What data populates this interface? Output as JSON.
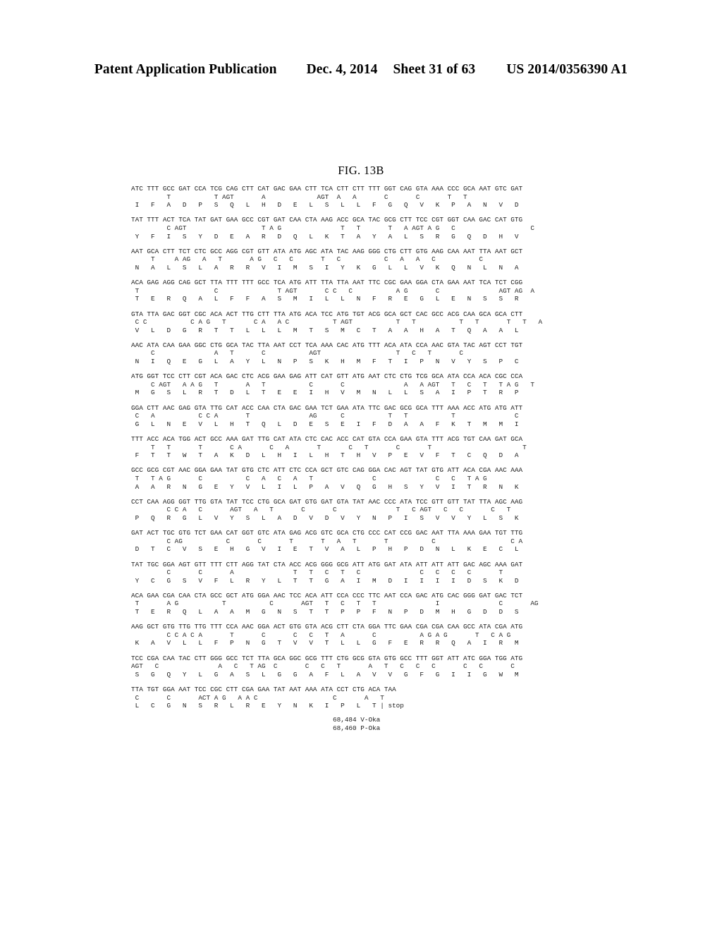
{
  "header": {
    "publication": "Patent Application Publication",
    "date": "Dec. 4, 2014",
    "sheet": "Sheet 31 of 63",
    "patent_number": "US 2014/0356390 A1"
  },
  "figure": {
    "title": "FIG. 13B"
  },
  "sequence": {
    "blocks": [
      {
        "codons": "ATC TTT GCC GAT CCA TCG CAG CTT CAT GAC GAA CTT TCA CTT CTT TTT GGT CAG GTA AAA CCC GCA AAT GTC GAT",
        "variants": "         T           T AGT       A             AGT  A   A       C       C       T   T",
        "protein": " I   F   A   D   P   S   Q   L   H   D   E   L   S   L   L   F   G   Q   V   K   P   A   N   V   D"
      },
      {
        "codons": "TAT TTT ACT TCA TAT GAT GAA GCC CGT GAT CAA CTA AAG ACC GCA TAC GCG CTT TCC CGT GGT CAA GAC CAT GTG",
        "variants": "         C AGT                   T A G               T   T       T   A AGT A G   C                   C",
        "protein": " Y   F   I   S   Y   D   E   A   R   D   Q   L   K   T   A   Y   A   L   S   R   G   Q   D   H   V"
      },
      {
        "codons": "AAT GCA CTT TCT CTC GCC AGG CGT GTT ATA ATG AGC ATA TAC AAG GGG CTG CTT GTG AAG CAA AAT TTA AAT GCT",
        "variants": "     T     A AG   A   T       A G   C   C       T   C           C   A   A   C           C",
        "protein": " N   A   L   S   L   A   R   R   V   I   M   S   I   Y   K   G   L   L   V   K   Q   N   L   N   A"
      },
      {
        "codons": "ACA GAG AGG CAG GCT TTA TTT TTT GCC TCA ATG ATT TTA TTA AAT TTC CGC GAA GGA CTA GAA AAT TCA TCT CGG",
        "variants": " T                   C               T AGT       C C   C           A G       C               AGT AG  A",
        "protein": " T   E   R   Q   A   L   F   F   A   S   M   I   L   L   N   F   R   E   G   L   E   N   S   S   R"
      },
      {
        "codons": "GTA TTA GAC GGT CGC ACA ACT TTG CTT TTA ATG ACA TCC ATG TGT ACG GCA GCT CAC GCC ACG CAA GCA GCA CTT",
        "variants": " C C           C A G   T       C A   A C           T AGT           T   T           T   T       T   T   A",
        "protein": " V   L   D   G   R   T   T   L   L   L   M   T   S   M   C   T   A   A   H   A   T   Q   A   A   L"
      },
      {
        "codons": "AAC ATA CAA GAA GGC CTG GCA TAC TTA AAT CCT TCA AAA CAC ATG TTT ACA ATA CCA AAC GTA TAC AGT CCT TGT",
        "variants": "     C               A   T       C           AGT                   T   C   T       C",
        "protein": " N   I   Q   E   G   L   A   Y   L   N   P   S   K   H   M   F   T   I   P   N   V   Y   S   P   C"
      },
      {
        "codons": "ATG GGT TCC CTT CGT ACA GAC CTC ACG GAA GAG ATT CAT GTT ATG AAT CTC CTG TCG GCA ATA CCA ACA CGC CCA",
        "variants": "     C AGT   A A G   T       A   T           C       C               A   A AGT   T   C   T   T A G   T",
        "protein": " M   G   S   L   R   T   D   L   T   E   E   I   H   V   M   N   L   L   S   A   I   P   T   R   P"
      },
      {
        "codons": "GGA CTT AAC GAG GTA TTG CAT ACC CAA CTA GAC GAA TCT GAA ATA TTC GAC GCG GCA TTT AAA ACC ATG ATG ATT",
        "variants": " C   A           C C A       T               AG      C           T   T           T               C",
        "protein": " G   L   N   E   V   L   H   T   Q   L   D   E   S   E   I   F   D   A   A   F   K   T   M   M   I"
      },
      {
        "codons": "TTT ACC ACA TGG ACT GCC AAA GAT TTG CAT ATA CTC CAC ACC CAT GTA CCA GAA GTA TTT ACG TGT CAA GAT GCA",
        "variants": "     T   T       T       C A       C   A       T       C   T       C       T                       T",
        "protein": " F   T   T   W   T   A   K   D   L   H   I   L   H   T   H   V   P   E   V   F   T   C   Q   D   A"
      },
      {
        "codons": "GCC GCG CGT AAC GGA GAA TAT GTG CTC ATT CTC CCA GCT GTC CAG GGA CAC AGT TAT GTG ATT ACA CGA AAC AAA",
        "variants": " T   T A G       C           C   A   C   A   T               C               C   C   T A G",
        "protein": " A   A   R   N   G   E   Y   V   L   I   L   P   A   V   Q   G   H   S   Y   V   I   T   R   N   K"
      },
      {
        "codons": "CCT CAA AGG GGT TTG GTA TAT TCC CTG GCA GAT GTG GAT GTA TAT AAC CCC ATA TCC GTT GTT TAT TTA AGC AAG",
        "variants": "         C C A   C       AGT   A   T       C       C               T   C AGT   C   C       C   T",
        "protein": " P   Q   R   G   L   V   Y   S   L   A   D   V   D   V   Y   N   P   I   S   V   V   Y   L   S   K"
      },
      {
        "codons": "GAT ACT TGC GTG TCT GAA CAT GGT GTC ATA GAG ACG GTC GCA CTG CCC CAT CCG GAC AAT TTA AAA GAA TGT TTG",
        "variants": "         C AG           C       C       T       T   A   T       T           C                   C A",
        "protein": " D   T   C   V   S   E   H   G   V   I   E   T   V   A   L   P   H   P   D   N   L   K   E   C   L"
      },
      {
        "codons": "TAT TGC GGA AGT GTT TTT CTT AGG TAT CTA ACC ACG GGG GCG ATT ATG GAT ATA ATT ATT ATT GAC AGC AAA GAT",
        "variants": "         C       C       A               T   T   C   T   C               C   C   C   C       T",
        "protein": " Y   C   G   S   V   F   L   R   Y   L   T   T   G   A   I   M   D   I   I   I   I   D   S   K   D"
      },
      {
        "codons": "ACA GAA CGA CAA CTA GCC GCT ATG GGA AAC TCC ACA ATT CCA CCC TTC AAT CCA GAC ATG CAC GGG GAT GAC TCT",
        "variants": " T       A G           T           C       AGT   T   C   T   T               I               C       AG",
        "protein": " T   E   R   Q   L   A   A   M   G   N   S   T   T   P   P   F   N   P   D   M   H   G   D   D   S"
      },
      {
        "codons": "AAG GCT GTG TTG TTG TTT CCA AAC GGA ACT GTG GTA ACG CTT CTA GGA TTC GAA CGA CGA CAA GCC ATA CGA ATG",
        "variants": "         C C A C A       T       C       C   C   T   A       C           A G A G       T   C A G",
        "protein": " K   A   V   L   L   F   P   N   G   T   V   V   T   L   L   G   F   E   R   R   Q   A   I   R   M"
      },
      {
        "codons": "TCC CGA CAA TAC CTT GGG GCC TCT TTA GCA GGC GCG TTT CTG GCG GTA GTG GCC TTT GGT ATT ATC GGA TGG ATG",
        "variants": "AGT   C               A   C   T AG  C       C   C   T       A   T   C   C   C       C   C       C",
        "protein": " S   G   Q   Y   L   G   A   S   L   G   G   A   F   L   A   V   V   G   F   G   I   I   G   W   M"
      },
      {
        "codons": "TTA TGT GGA AAT TCC CGC CTT CGA GAA TAT AAT AAA ATA CCT CTG ACA TAA",
        "variants": " C       C       ACT A G   A A C                   C       A   T",
        "protein": " L   C   G   N   S   R   L   R   E   Y   N   K   I   P   L   T | stop"
      }
    ],
    "footer_notes": [
      "68,484 V-Oka",
      "68,460 P-Oka"
    ]
  }
}
